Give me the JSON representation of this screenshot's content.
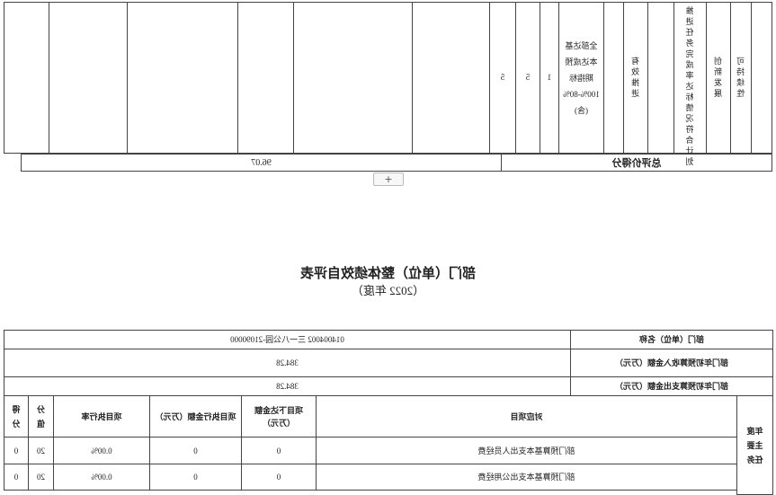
{
  "upper_table": {
    "score_col_1": "5",
    "score_col_2": "5",
    "score_col_3": "1",
    "metric_text_lines": [
      "全部达基",
      "本达成预",
      "期指标",
      "100%-80%",
      "(含)"
    ],
    "indicator": "有效推进",
    "indicator_desc": "推进任务完成率达标情况符合计划",
    "category": "创新发展",
    "category_sub": "可持续性",
    "total_label": "总评价得分",
    "total_value": "96.07",
    "add_button": "+"
  },
  "report": {
    "title": "部门（单位）整体绩效自评表",
    "year": "（2022 年度）"
  },
  "lower_table": {
    "dept_label": "部门（单位）名称",
    "dept_value": "014004002 三一八公园-21090000",
    "budget_income_label": "部门年初预算收入金额（万元）",
    "budget_income_value": "384.28",
    "budget_expense_label": "部门年初预算支出金额（万元）",
    "budget_expense_value": "384.28",
    "side_label": "年度主要任务",
    "headers": {
      "project": "对应项目",
      "allocated": "项目下达金额（万元）",
      "executed": "项目执行金额（万元）",
      "rate": "项目执行率",
      "weight": "分值",
      "score": "得分"
    },
    "rows": [
      {
        "project": "部门预算基本支出人员经费",
        "allocated": "0",
        "executed": "0",
        "rate": "0.00%",
        "weight": "20",
        "score": "0"
      },
      {
        "project": "部门预算基本支出公用经费",
        "allocated": "0",
        "executed": "0",
        "rate": "0.00%",
        "weight": "20",
        "score": "0"
      }
    ]
  }
}
